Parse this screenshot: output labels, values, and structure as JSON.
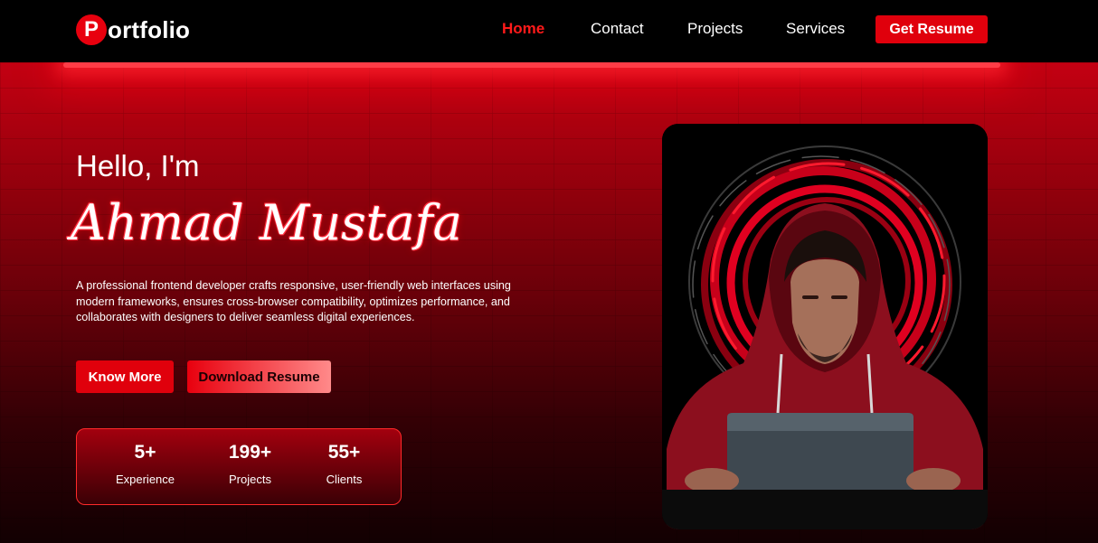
{
  "nav": {
    "logo_badge": "P",
    "logo_text": "ortfolio",
    "links": [
      {
        "label": "Home",
        "active": true
      },
      {
        "label": "Contact",
        "active": false
      },
      {
        "label": "Projects",
        "active": false
      },
      {
        "label": "Services",
        "active": false
      }
    ],
    "resume_button": "Get Resume"
  },
  "hero": {
    "greeting": "Hello, I'm",
    "name": "Ahmad Mustafa",
    "description": "A professional frontend developer crafts responsive, user-friendly web interfaces using modern frameworks, ensures cross-browser compatibility, optimizes performance, and collaborates with designers to deliver seamless digital experiences.",
    "buttons": {
      "know_more": "Know More",
      "download_resume": "Download Resume"
    },
    "stats": [
      {
        "value": "5+",
        "label": "Experience"
      },
      {
        "value": "199+",
        "label": "Projects"
      },
      {
        "value": "55+",
        "label": "Clients"
      }
    ],
    "photo_icon": "hooded-developer-laptop-photo"
  },
  "colors": {
    "accent": "#e0000c",
    "nav_bg": "#000000"
  }
}
